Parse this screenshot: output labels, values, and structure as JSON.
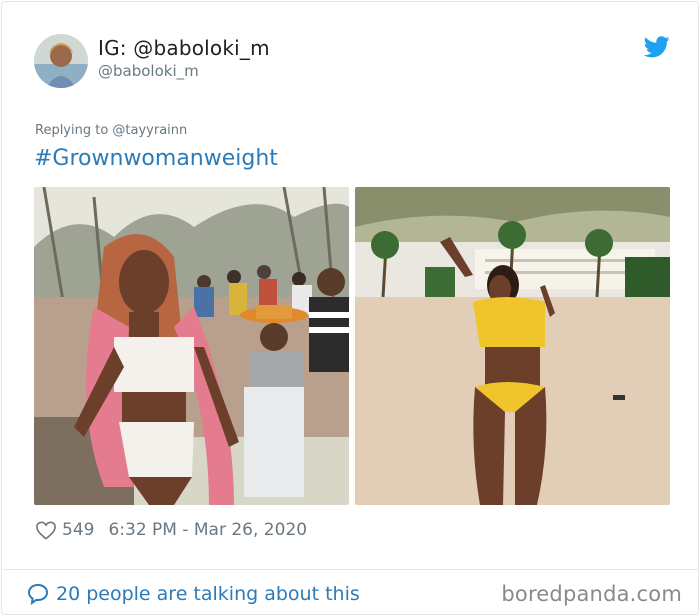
{
  "tweet": {
    "display_name": "IG: @baboloki_m",
    "handle": "@baboloki_m",
    "replying_to": "Replying to @tayyrainn",
    "hashtag": "#Grownwomanweight",
    "likes": "549",
    "timestamp": "6:32 PM - Mar 26, 2020",
    "conversation": "20 people are talking about this"
  },
  "watermark": "boredpanda.com",
  "icons": {
    "brand": "twitter-bird-icon",
    "like": "heart-icon",
    "reply": "speech-bubble-icon"
  },
  "colors": {
    "twitter_blue": "#1da1f2",
    "link_blue": "#2b7bb9",
    "muted_text": "#697882",
    "primary_text": "#1c2022"
  }
}
